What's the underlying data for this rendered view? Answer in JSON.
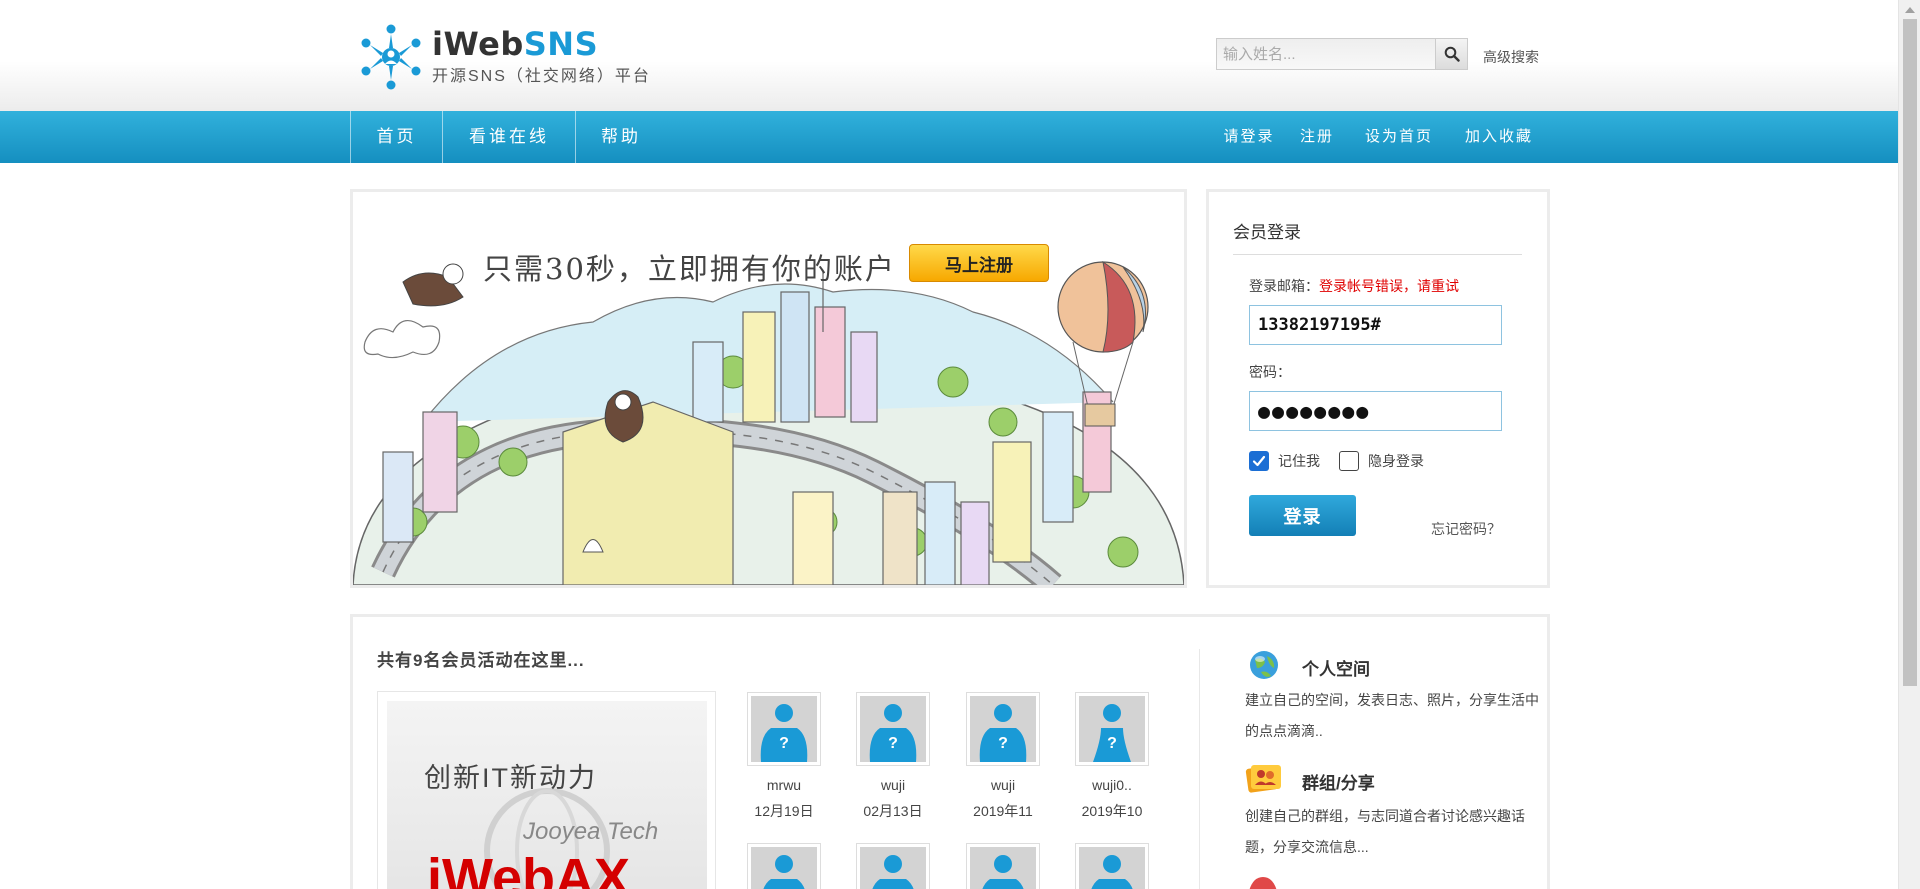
{
  "header": {
    "logo_word_a": "iWeb",
    "logo_word_b": "SNS",
    "logo_sub": "开源SNS（社交网络）平台",
    "search_placeholder": "输入姓名...",
    "advanced_search": "高级搜索"
  },
  "nav": {
    "left": [
      "首页",
      "看谁在线",
      "帮助"
    ],
    "right": [
      "请登录",
      "注册",
      "设为首页",
      "加入收藏"
    ]
  },
  "banner": {
    "slogan": "只需30秒，立即拥有你的账户",
    "register_button": "马上注册"
  },
  "login": {
    "title": "会员登录",
    "email_label": "登录邮箱：",
    "error": "登录帐号错误，请重试",
    "email_value": "13382197195#",
    "password_label": "密码：",
    "password_value": "●●●●●●●●",
    "remember": "记住我",
    "remember_checked": true,
    "invisible": "隐身登录",
    "invisible_checked": false,
    "submit": "登录",
    "forgot": "忘记密码？"
  },
  "members": {
    "title": "共有9名会员活动在这里...",
    "promo": {
      "line1": "创新IT新动力",
      "line2": "Jooyea Tech",
      "line3": "iWebAX"
    },
    "list": [
      {
        "name": "mrwu",
        "date": "12月19日"
      },
      {
        "name": "wuji",
        "date": "02月13日"
      },
      {
        "name": "wuji",
        "date": "2019年11"
      },
      {
        "name": "wuji0..",
        "date": "2019年10"
      }
    ]
  },
  "features": [
    {
      "title": "个人空间",
      "desc": "建立自己的空间，发表日志、照片，分享生活中的点点滴滴..",
      "icon": "globe-icon"
    },
    {
      "title": "群组/分享",
      "desc": "创建自己的群组，与志同道合者讨论感兴趣话题，分享交流信息...",
      "icon": "group-icon"
    }
  ],
  "colors": {
    "nav": "#1a9ad6",
    "accent": "#1a9ad6",
    "error": "#e00000",
    "register": "#f7a800"
  }
}
